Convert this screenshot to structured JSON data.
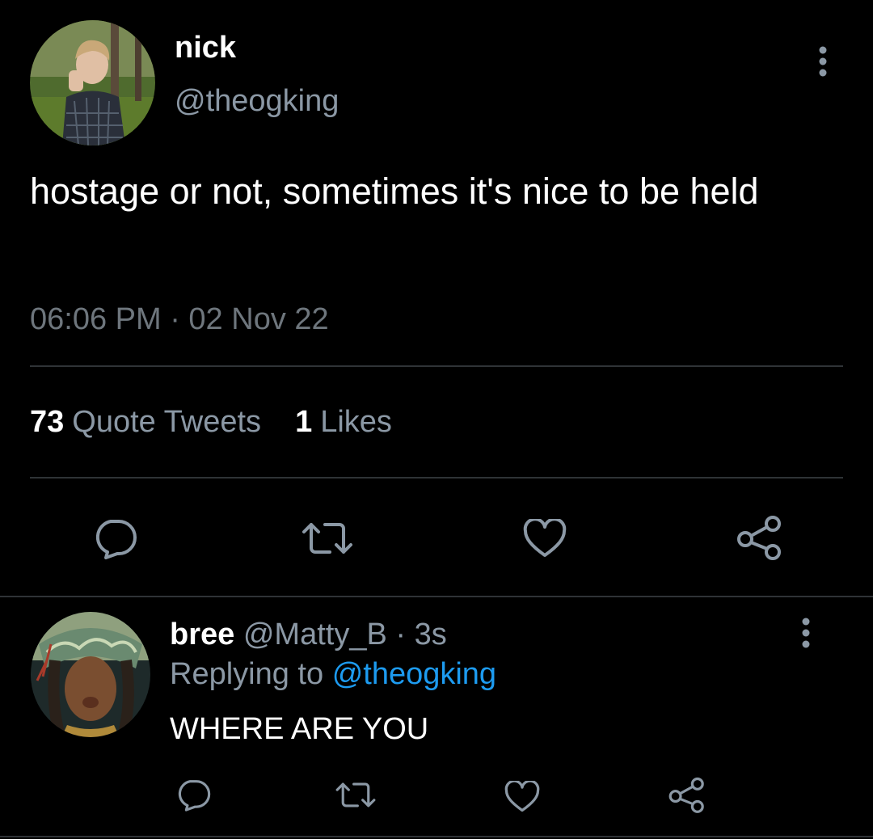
{
  "tweet": {
    "author_name": "nick",
    "author_handle": "@theogking",
    "text": "hostage or not, sometimes it's nice to be held",
    "timestamp": "06:06 PM · 02 Nov 22",
    "stats": {
      "quote_tweets_count": "73",
      "quote_tweets_label": "Quote Tweets",
      "likes_count": "1",
      "likes_label": "Likes"
    }
  },
  "reply": {
    "author_name": "bree",
    "author_meta": "@Matty_B · 3s",
    "replying_prefix": "Replying to",
    "replying_handle": "@theogking",
    "text": "WHERE ARE YOU"
  },
  "icons": {
    "reply": "reply-icon",
    "retweet": "retweet-icon",
    "like": "heart-icon",
    "share": "share-icon",
    "more": "more-vertical-icon"
  },
  "colors": {
    "background": "#000000",
    "secondary_text": "#8b98a5",
    "timestamp_text": "#6e767d",
    "divider": "#2f3336",
    "link": "#1d9bf0",
    "icon": "#8b98a5"
  }
}
